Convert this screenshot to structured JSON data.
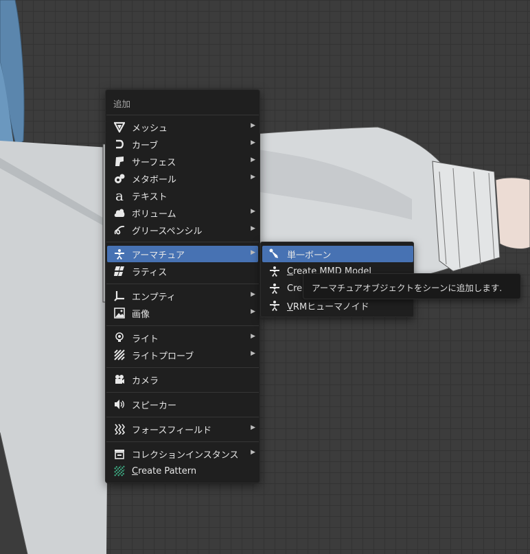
{
  "colors": {
    "viewport_bg": "#3c3c3c",
    "menu_bg": "#1f1f1f",
    "highlight": "#4772b3",
    "pattern_icon": "#3fb58a"
  },
  "add_menu": {
    "title": "追加",
    "items": [
      {
        "label": "メッシュ",
        "icon": "mesh-icon",
        "submenu": true
      },
      {
        "label": "カーブ",
        "icon": "curve-icon",
        "submenu": true
      },
      {
        "label": "サーフェス",
        "icon": "surface-icon",
        "submenu": true
      },
      {
        "label": "メタボール",
        "icon": "metaball-icon",
        "submenu": true
      },
      {
        "label": "テキスト",
        "icon": "text-icon",
        "submenu": false
      },
      {
        "label": "ボリューム",
        "icon": "volume-icon",
        "submenu": true
      },
      {
        "label": "グリースペンシル",
        "icon": "grease-pencil-icon",
        "submenu": true
      },
      {
        "label": "アーマチュア",
        "icon": "armature-icon",
        "submenu": true,
        "active": true
      },
      {
        "label": "ラティス",
        "icon": "lattice-icon",
        "submenu": false
      },
      {
        "label": "エンプティ",
        "icon": "empty-icon",
        "submenu": true
      },
      {
        "label": "画像",
        "icon": "image-icon",
        "submenu": true
      },
      {
        "label": "ライト",
        "icon": "light-icon",
        "submenu": true
      },
      {
        "label": "ライトプローブ",
        "icon": "light-probe-icon",
        "submenu": true
      },
      {
        "label": "カメラ",
        "icon": "camera-icon",
        "submenu": false
      },
      {
        "label": "スピーカー",
        "icon": "speaker-icon",
        "submenu": false
      },
      {
        "label": "フォースフィールド",
        "icon": "force-field-icon",
        "submenu": true
      },
      {
        "label": "コレクションインスタンス",
        "icon": "collection-instance-icon",
        "submenu": true
      },
      {
        "label_prefix": "C",
        "label_rest": "reate Pattern",
        "icon": "pattern-icon",
        "submenu": false
      }
    ]
  },
  "armature_submenu": {
    "items": [
      {
        "label": "単一ボーン",
        "icon": "bone-icon",
        "active": true
      },
      {
        "label_prefix": "C",
        "label_rest": "reate MMD Model",
        "icon": "armature-icon"
      },
      {
        "label_prefix": "C",
        "label_rest": "re",
        "icon": "armature-icon"
      },
      {
        "label_prefix": "V",
        "label_rest": "RMヒューマノイド",
        "icon": "armature-icon"
      }
    ]
  },
  "tooltip": {
    "text": "アーマチュアオブジェクトをシーンに追加します."
  }
}
